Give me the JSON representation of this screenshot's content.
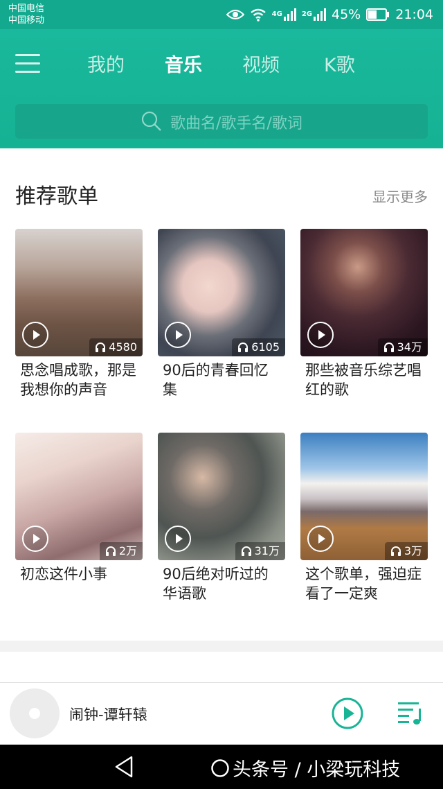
{
  "status_bar": {
    "carrier_1": "中国电信",
    "carrier_2": "中国移动",
    "net_1": "4G",
    "net_2": "2G",
    "battery": "45%",
    "time": "21:04",
    "icons": [
      "eye-icon",
      "wifi-icon",
      "signal-icon",
      "battery-icon"
    ]
  },
  "header": {
    "tabs": [
      {
        "label": "我的",
        "active": false
      },
      {
        "label": "音乐",
        "active": true
      },
      {
        "label": "视频",
        "active": false
      },
      {
        "label": "K歌",
        "active": false
      }
    ],
    "search_placeholder": "歌曲名/歌手名/歌词",
    "accent_color": "#1ab89c"
  },
  "section": {
    "title": "推荐歌单",
    "more_label": "显示更多"
  },
  "playlists": [
    {
      "title": "思念唱成歌，那是我想你的声音",
      "count": "4580"
    },
    {
      "title": "90后的青春回忆集",
      "count": "6105"
    },
    {
      "title": "那些被音乐综艺唱红的歌",
      "count": "34万"
    },
    {
      "title": "初恋这件小事",
      "count": "2万"
    },
    {
      "title": "90后绝对听过的华语歌",
      "count": "31万"
    },
    {
      "title": "这个歌单，强迫症看了一定爽",
      "count": "3万"
    }
  ],
  "player": {
    "song": "闹钟-谭轩辕"
  },
  "navbar": {
    "watermark": "头条号 / 小梁玩科技"
  }
}
